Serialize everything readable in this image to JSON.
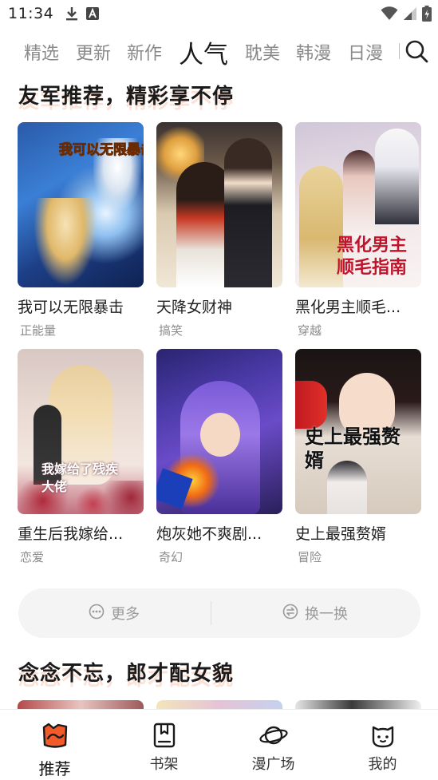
{
  "status_bar": {
    "time": "11:34",
    "left_icons": [
      "download-icon",
      "a-notification-icon"
    ],
    "right_icons": [
      "wifi-icon",
      "signal-icon",
      "battery-icon"
    ]
  },
  "tabs": [
    {
      "label": "精选",
      "active": false
    },
    {
      "label": "更新",
      "active": false
    },
    {
      "label": "新作",
      "active": false
    },
    {
      "label": "人气",
      "active": true
    },
    {
      "label": "耽美",
      "active": false
    },
    {
      "label": "韩漫",
      "active": false
    },
    {
      "label": "日漫",
      "active": false
    }
  ],
  "section1": {
    "title": "友军推荐，精彩享不停",
    "cards": [
      {
        "title": "我可以无限暴击",
        "tag": "正能量",
        "cover_text": "我可以无限暴击"
      },
      {
        "title": "天降女财神",
        "tag": "搞笑"
      },
      {
        "title": "黑化男主顺毛...",
        "tag": "穿越",
        "cover_text": "黑化男主顺毛指南"
      },
      {
        "title": "重生后我嫁给...",
        "tag": "恋爱",
        "cover_text": "我嫁给了残疾大佬"
      },
      {
        "title": "炮灰她不爽剧...",
        "tag": "奇幻"
      },
      {
        "title": "史上最强赘婿",
        "tag": "冒险",
        "cover_text": "史上最强赘婿"
      }
    ]
  },
  "actions": {
    "more_label": "更多",
    "refresh_label": "换一换"
  },
  "section2": {
    "title": "念念不忘，郎才配女貌"
  },
  "bottom_nav": [
    {
      "label": "推荐",
      "icon": "recommend-icon",
      "active": true
    },
    {
      "label": "书架",
      "icon": "bookshelf-icon",
      "active": false
    },
    {
      "label": "漫广场",
      "icon": "planet-icon",
      "active": false
    },
    {
      "label": "我的",
      "icon": "cat-face-icon",
      "active": false
    }
  ],
  "colors": {
    "accent": "#f25a2a",
    "title_underline": "#fac8b4",
    "inactive_text": "#8a8a8a"
  }
}
